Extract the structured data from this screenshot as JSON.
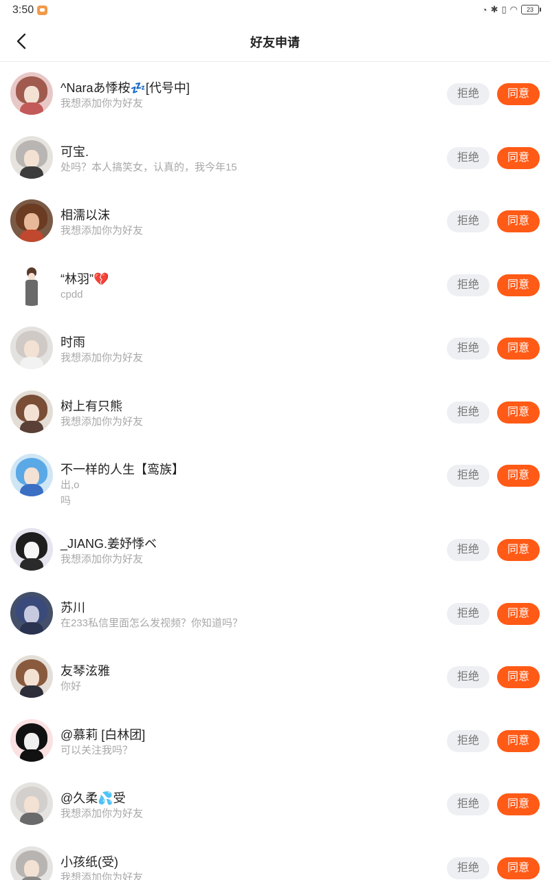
{
  "status_bar": {
    "time": "3:50",
    "battery": "23"
  },
  "header": {
    "title": "好友申请"
  },
  "actions": {
    "reject_label": "拒绝",
    "accept_label": "同意"
  },
  "requests": [
    {
      "name": "^Naraあ悸桉💤[代号中]",
      "message": "我想添加你为好友"
    },
    {
      "name": "可宝.",
      "message": "处吗？本人搞笑女，认真的，我今年15"
    },
    {
      "name": "相濡以沫",
      "message": "我想添加你为好友"
    },
    {
      "name": "“林羽”💔",
      "message": "cpdd"
    },
    {
      "name": "时雨",
      "message": "我想添加你为好友"
    },
    {
      "name": "树上有只熊",
      "message": "我想添加你为好友"
    },
    {
      "name": "不一样的人生【鸾族】",
      "message": "出,o\n吗"
    },
    {
      "name": "_JIANG.姜妤悸ベ",
      "message": "我想添加你为好友"
    },
    {
      "name": "苏川",
      "message": "在233私信里面怎么发视频？你知道吗？"
    },
    {
      "name": "友琴泫雅",
      "message": "你好"
    },
    {
      "name": "@慕莉 [白林团]",
      "message": "可以关注我吗？"
    },
    {
      "name": "@久柔💦受",
      "message": "我想添加你为好友"
    },
    {
      "name": "小孩纸(受)",
      "message": "我想添加你为好友"
    }
  ]
}
